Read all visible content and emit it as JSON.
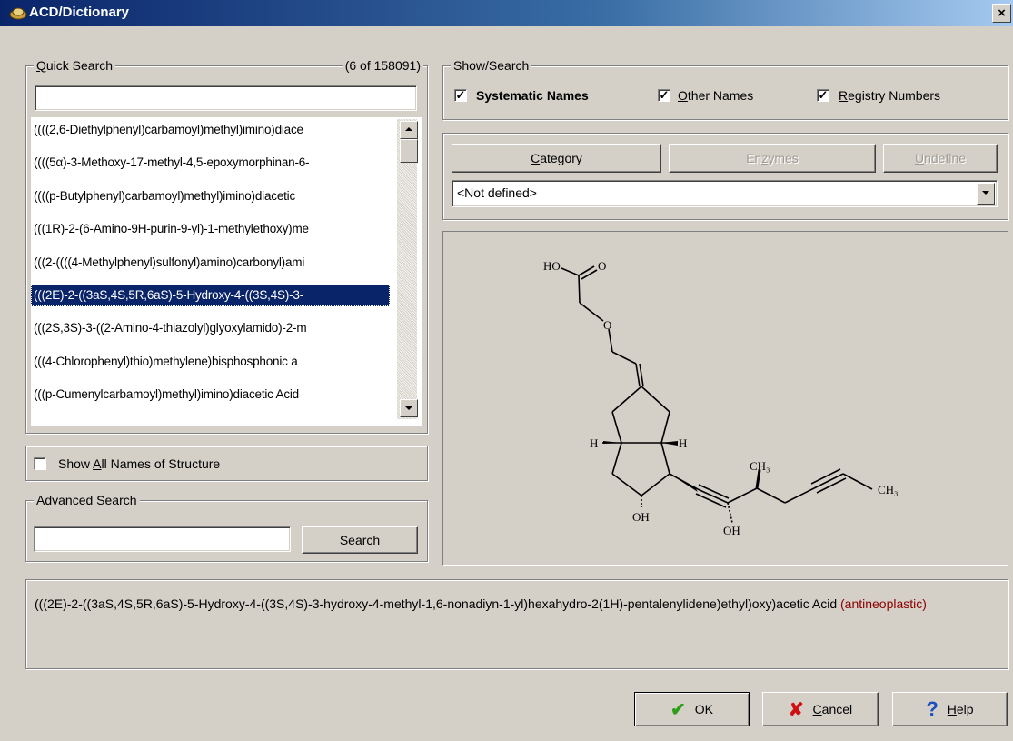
{
  "window": {
    "title": "ACD/Dictionary",
    "close": "×"
  },
  "quick_search": {
    "label_q": "Q",
    "label_rest": "uick Search",
    "count": "(6 of 158091)",
    "value": "",
    "results": [
      "((((2,6-Diethylphenyl)carbamoyl)methyl)imino)diace",
      "((((5α)-3-Methoxy-17-methyl-4,5-epoxymorphinan-6-",
      "((((p-Butylphenyl)carbamoyl)methyl)imino)diacetic",
      "(((1R)-2-(6-Amino-9H-purin-9-yl)-1-methylethoxy)me",
      "(((2-((((4-Methylphenyl)sulfonyl)amino)carbonyl)ami",
      "(((2E)-2-((3aS,4S,5R,6aS)-5-Hydroxy-4-((3S,4S)-3-",
      "(((2S,3S)-3-((2-Amino-4-thiazolyl)glyoxylamido)-2-m",
      "(((4-Chlorophenyl)thio)methylene)bisphosphonic a",
      "(((p-Cumenylcarbamoyl)methyl)imino)diacetic Acid"
    ],
    "selected_index": 5
  },
  "show_all": {
    "pre": "Show ",
    "u": "A",
    "post": "ll Names of Structure",
    "checked": false
  },
  "advanced_search": {
    "label_pre": "Advanced ",
    "label_u": "S",
    "label_post": "earch",
    "value": "",
    "button_pre": "S",
    "button_u": "e",
    "button_post": "arch"
  },
  "show_search": {
    "label": "Show/Search",
    "systematic": {
      "label": "Systematic Names",
      "checked": true
    },
    "other": {
      "u": "O",
      "rest": "ther Names",
      "checked": true
    },
    "registry": {
      "u": "R",
      "rest": "egistry Numbers",
      "checked": true
    },
    "check_mark": "✓"
  },
  "category": {
    "category_u": "C",
    "category_rest": "ategory",
    "enzymes_pre": "En",
    "enzymes_u": "z",
    "enzymes_post": "ymes",
    "undefine_u": "U",
    "undefine_rest": "ndefine",
    "selected": "<Not defined>"
  },
  "structure_labels": {
    "ho": "HO",
    "o_top": "O",
    "o_ether": "O",
    "h_left": "H",
    "h_right": "H",
    "ch3_methyl": "CH₃",
    "ch3_end": "CH₃",
    "oh_left": "OH",
    "oh_right": "OH"
  },
  "description": {
    "name": "(((2E)-2-((3aS,4S,5R,6aS)-5-Hydroxy-4-((3S,4S)-3-hydroxy-4-methyl-1,6-nonadiyn-1-yl)hexahydro-2(1H)-pentalenylidene)ethyl)oxy)acetic Acid",
    "category": "(antineoplastic)",
    "category_color": "#8b0000"
  },
  "buttons": {
    "ok": "OK",
    "cancel_u": "C",
    "cancel_rest": "ancel",
    "help_u": "H",
    "help_rest": "elp",
    "ok_color": "#2e9e1a",
    "cancel_color": "#d01010",
    "help_color": "#1c4fc0"
  }
}
